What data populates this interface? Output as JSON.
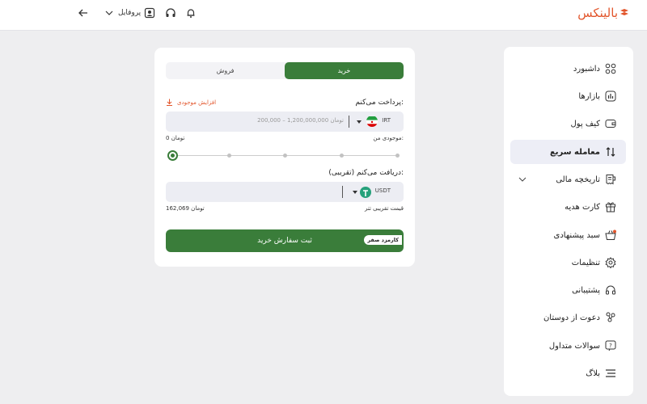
{
  "header": {
    "logo": "بالینکس",
    "profile_label": "پروفایل"
  },
  "sidebar": {
    "items": [
      {
        "label": "داشبورد",
        "icon": "dashboard-icon"
      },
      {
        "label": "بازارها",
        "icon": "markets-icon"
      },
      {
        "label": "کیف پول",
        "icon": "wallet-icon"
      },
      {
        "label": "معامله سریع",
        "icon": "swap-arrows-icon",
        "active": true
      },
      {
        "label": "تاریخچه مالی",
        "icon": "history-icon"
      },
      {
        "label": "کارت هدیه",
        "icon": "gift-icon"
      },
      {
        "label": "سبد پیشنهادی",
        "icon": "basket-icon"
      },
      {
        "label": "تنظیمات",
        "icon": "gear-icon"
      },
      {
        "label": "پشتیبانی",
        "icon": "headset-icon"
      },
      {
        "label": "دعوت از دوستان",
        "icon": "invite-icon"
      },
      {
        "label": "سوالات متداول",
        "icon": "faq-icon"
      },
      {
        "label": "بلاگ",
        "icon": "blog-icon"
      }
    ]
  },
  "trade": {
    "tab_buy": "خرید",
    "tab_sell": "فروش",
    "pay_label": "پرداخت می‌کنم:",
    "increase_balance": "افزایش موجودی",
    "pay_currency": "IRT",
    "pay_placeholder": "200,000 – 1,200,000,000 تومان",
    "balance_label": "موجودی من:",
    "balance_value": "0 تومان",
    "receive_label": "دریافت می‌کنم (تقریبی):",
    "receive_currency": "USDT",
    "price_label": "قیمت تقریبی تتر",
    "price_value": "162,069 تومان",
    "submit_label": "ثبت سفارش خرید",
    "fee_badge": "کارمزد صفر",
    "slider_percent": 0
  },
  "colors": {
    "accent": "#e2552b",
    "primary_green": "#3a7d3a",
    "active_bg": "#edeef6"
  }
}
